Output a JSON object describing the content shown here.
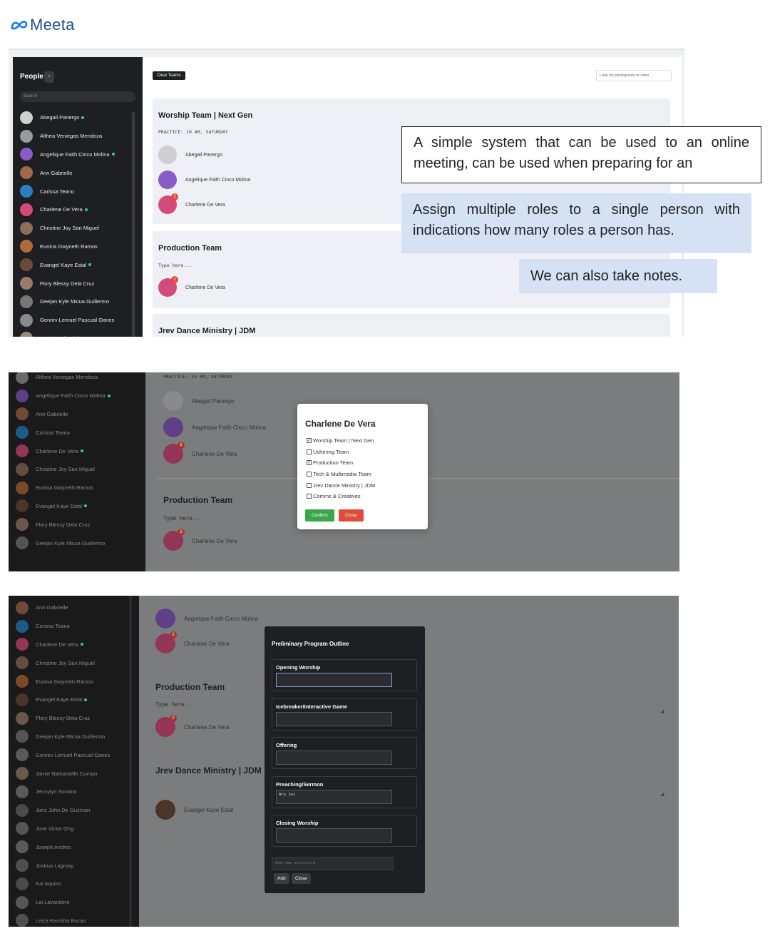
{
  "logo": {
    "text": "Meeta"
  },
  "panel1": {
    "sidebar": {
      "title": "People",
      "add_label": "+",
      "search_placeholder": "Search",
      "people": [
        {
          "name": "Abegail Panergo",
          "online": true,
          "color": "#cfcfcf"
        },
        {
          "name": "Althea Veniegas Mendoza",
          "online": false,
          "color": "#9a9a9a"
        },
        {
          "name": "Angelique Faith Cinco Molina",
          "online": true,
          "color": "#8a5bc4"
        },
        {
          "name": "Ann Gabrielle",
          "online": false,
          "color": "#a0674a"
        },
        {
          "name": "Carissa Teano",
          "online": false,
          "color": "#2a7fc0"
        },
        {
          "name": "Charlene De Vera",
          "online": true,
          "color": "#d24b7a"
        },
        {
          "name": "Christine Joy San Miguel",
          "online": false,
          "color": "#8c6e5a"
        },
        {
          "name": "Eunina Gwyneth Ramos",
          "online": false,
          "color": "#b06a3a"
        },
        {
          "name": "Evangel Kaye Estal",
          "online": true,
          "color": "#6b4a3a"
        },
        {
          "name": "Flory Blessy Dela Cruz",
          "online": false,
          "color": "#9a7a6a"
        },
        {
          "name": "Geejan Kyle Micua Guillermo",
          "online": false,
          "color": "#777777"
        },
        {
          "name": "Genrev Lemuel Pascual Oanes",
          "online": false,
          "color": "#8a8a8a"
        },
        {
          "name": "Jamie Nathanielle Cuerpo",
          "online": false,
          "color": "#9a8a7a"
        }
      ]
    },
    "main": {
      "clear_label": "Clear Teams",
      "look_placeholder": "Look for participants or roles ..",
      "teams": [
        {
          "title": "Worship Team | Next Gen",
          "note": "PRACTICE: 10 AM, SATURDAY",
          "members": [
            {
              "name": "Abegail Panergo",
              "color": "#cfcfcf",
              "badge": ""
            },
            {
              "name": "Angelique Faith Cinco Molina",
              "color": "#8a5bc4",
              "badge": ""
            },
            {
              "name": "Charlene De Vera",
              "color": "#d24b7a",
              "badge": "2"
            }
          ]
        },
        {
          "title": "Production Team",
          "note": "Type here...",
          "members": [
            {
              "name": "Charlene De Vera",
              "color": "#d24b7a",
              "badge": "2"
            }
          ]
        },
        {
          "title": "Jrev Dance Ministry | JDM",
          "note": "",
          "members": []
        }
      ]
    }
  },
  "annotations": {
    "a1": "A simple system that can be used to an online meeting, can be used when preparing for an",
    "a2": "Assign multiple roles to a single person with indications how many roles a person has.",
    "a3": "We can also take notes."
  },
  "panel2": {
    "people": [
      {
        "name": "Althea Veniegas Mendoza",
        "online": false,
        "color": "#6a6a6a"
      },
      {
        "name": "Angelique Faith Cinco Molina",
        "online": true,
        "color": "#5e3f88"
      },
      {
        "name": "Ann Gabrielle",
        "online": false,
        "color": "#6f4a36"
      },
      {
        "name": "Carissa Teano",
        "online": false,
        "color": "#1f5a87"
      },
      {
        "name": "Charlene De Vera",
        "online": true,
        "color": "#933556"
      },
      {
        "name": "Christine Joy San Miguel",
        "online": false,
        "color": "#634d40"
      },
      {
        "name": "Eunina Gwyneth Ramos",
        "online": false,
        "color": "#7b4a29"
      },
      {
        "name": "Evangel Kaye Estal",
        "online": true,
        "color": "#4b3429"
      },
      {
        "name": "Flory Blessy Dela Cruz",
        "online": false,
        "color": "#6c564a"
      },
      {
        "name": "Geejan Kyle Micua Guillermo",
        "online": false,
        "color": "#545454"
      }
    ],
    "bg": {
      "note": "PRACTICE: 10 AM, SATURDAY",
      "members": [
        "Abegail Panergo",
        "Angelique Faith Cinco Molina",
        "Charlene De Vera"
      ],
      "team2_title": "Production Team",
      "team2_note": "Type here...",
      "team2_member": "Charlene De Vera"
    },
    "modal": {
      "title": "Charlene De Vera",
      "options": [
        {
          "label": "Worship Team | Next Gen",
          "checked": true
        },
        {
          "label": "Ushering Team",
          "checked": false
        },
        {
          "label": "Production Team",
          "checked": true
        },
        {
          "label": "Tech & Multimedia Team",
          "checked": false
        },
        {
          "label": "Jrev Dance Ministry | JDM",
          "checked": false
        },
        {
          "label": "Comms & Creatives",
          "checked": false
        }
      ],
      "confirm_label": "Confirm",
      "close_label": "Close"
    }
  },
  "panel3": {
    "people": [
      {
        "name": "Ann Gabrielle",
        "online": false,
        "color": "#6f4a36"
      },
      {
        "name": "Carissa Teano",
        "online": false,
        "color": "#1f5a87"
      },
      {
        "name": "Charlene De Vera",
        "online": true,
        "color": "#933556"
      },
      {
        "name": "Christine Joy San Miguel",
        "online": false,
        "color": "#634d40"
      },
      {
        "name": "Eunina Gwyneth Ramos",
        "online": false,
        "color": "#7b4a29"
      },
      {
        "name": "Evangel Kaye Estal",
        "online": true,
        "color": "#4b3429"
      },
      {
        "name": "Flory Blessy Dela Cruz",
        "online": false,
        "color": "#6c564a"
      },
      {
        "name": "Geejan Kyle Micua Guillermo",
        "online": false,
        "color": "#545454"
      },
      {
        "name": "Genrev Lemuel Pascual Oanes",
        "online": false,
        "color": "#5a5a5a"
      },
      {
        "name": "Jamie Nathanielle Cuerpo",
        "online": false,
        "color": "#6a5a4a"
      },
      {
        "name": "Jennylyn Soriano",
        "online": false,
        "color": "#5a5a5a"
      },
      {
        "name": "Joriz John De Guzman",
        "online": false,
        "color": "#4a4a4a"
      },
      {
        "name": "Jose Victor Ong",
        "online": false,
        "color": "#555555"
      },
      {
        "name": "Joseph Andres",
        "online": false,
        "color": "#5a5a5a"
      },
      {
        "name": "Joshua Lagmay",
        "online": false,
        "color": "#4f4f4f"
      },
      {
        "name": "Kai Aquino",
        "online": false,
        "color": "#4a4a4a"
      },
      {
        "name": "Lai Lavandero",
        "online": false,
        "color": "#565656"
      },
      {
        "name": "Leica Kenisha Bucao",
        "online": false,
        "color": "#505050"
      }
    ],
    "bg": {
      "member1": "Angelique Faith Cinco Molina",
      "member2": "Charlene De Vera",
      "team2_title": "Production Team",
      "team2_note": "Type here...",
      "team2_member": "Charlene De Vera",
      "team3_title": "Jrev Dance Ministry | JDM",
      "team3_member": "Evangel Kaye Estal"
    },
    "modal": {
      "title": "Preliminary Program Outline",
      "sections": [
        {
          "label": "Opening Worship",
          "value": ""
        },
        {
          "label": "Icebreaker/Interactive Game",
          "value": ""
        },
        {
          "label": "Offering",
          "value": ""
        },
        {
          "label": "Preaching/Sermon",
          "value": "Ate Jez"
        },
        {
          "label": "Closing Worship",
          "value": ""
        }
      ],
      "new_placeholder": "Add new structure",
      "add_label": "Add",
      "close_label": "Close"
    }
  }
}
